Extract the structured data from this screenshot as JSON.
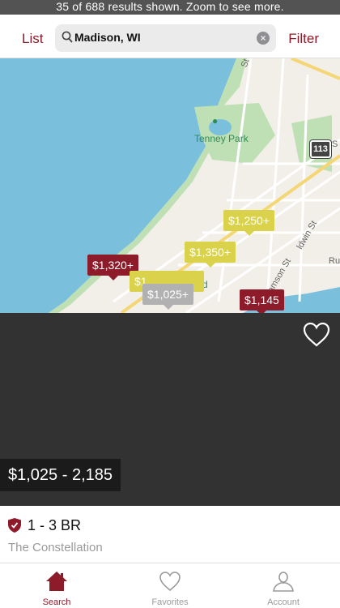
{
  "banner": {
    "text": "35 of 688 results shown. Zoom to see more."
  },
  "header": {
    "list_label": "List",
    "filter_label": "Filter",
    "search_value": "Madison, WI"
  },
  "map": {
    "poi": "Tenney Park",
    "poi2": "ield",
    "highway": "113",
    "streets": [
      "ldwin St",
      "amson St",
      "St",
      "Ru",
      "S"
    ],
    "pins": [
      {
        "label": "$1,250+",
        "color": "yellow"
      },
      {
        "label": "$1,350+",
        "color": "yellow"
      },
      {
        "label": "$1,320+",
        "color": "red"
      },
      {
        "label": "$1,",
        "color": "yellow"
      },
      {
        "label": "$1,025+",
        "color": "gray"
      },
      {
        "label": "$1,145",
        "color": "red"
      }
    ]
  },
  "listing": {
    "price_range": "$1,025 - 2,185",
    "bedrooms": "1 - 3 BR",
    "name": "The Constellation"
  },
  "tabs": [
    {
      "label": "Search",
      "icon": "house-icon",
      "active": true
    },
    {
      "label": "Favorites",
      "icon": "heart-icon",
      "active": false
    },
    {
      "label": "Account",
      "icon": "person-icon",
      "active": false
    }
  ],
  "colors": {
    "brand": "#8e1b2a",
    "pin_yellow": "#d9d24a",
    "pin_gray": "#b1b1b1",
    "water": "#7ac0dc"
  }
}
